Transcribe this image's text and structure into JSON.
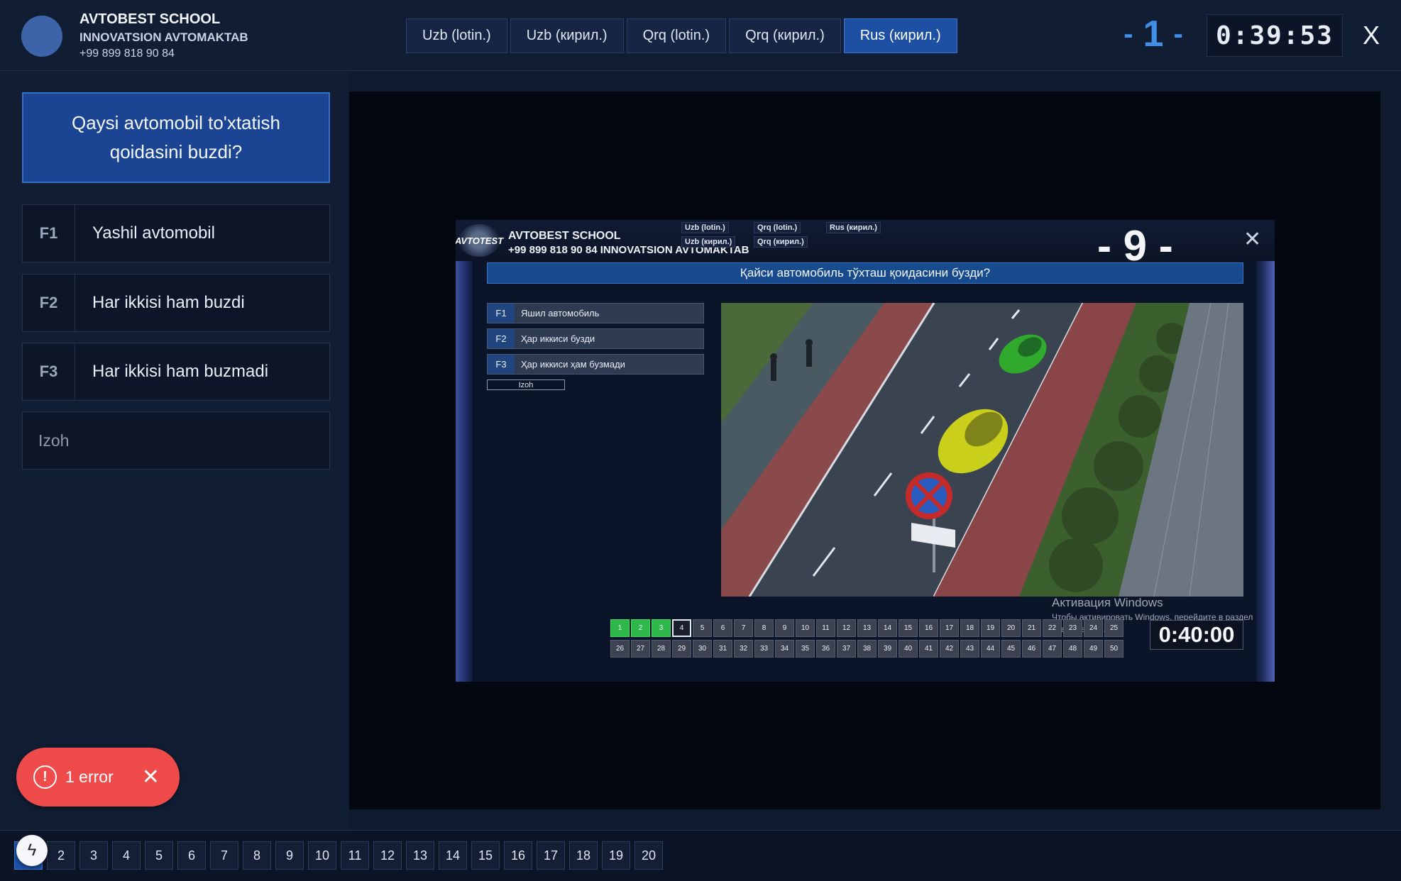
{
  "header": {
    "school_name": "AVTOBEST SCHOOL",
    "school_sub": "INNOVATSION AVTOMAKTAB",
    "phone": "+99 899 818 90 84",
    "languages": [
      "Uzb (lotin.)",
      "Uzb (кирил.)",
      "Qrq (lotin.)",
      "Qrq (кирил.)",
      "Rus (кирил.)"
    ],
    "active_language": "Rus (кирил.)",
    "question_number": "1",
    "dash": "-",
    "timer": "0:39:53",
    "close_label": "X"
  },
  "left_panel": {
    "question": "Qaysi avtomobil to'xtatish qoidasini buzdi?",
    "answers": [
      {
        "key": "F1",
        "text": "Yashil avtomobil"
      },
      {
        "key": "F2",
        "text": "Har ikkisi ham buzdi"
      },
      {
        "key": "F3",
        "text": "Har ikkisi ham buzmadi"
      }
    ],
    "izoh": "Izoh"
  },
  "error_toast": {
    "label": "1 error",
    "icon": "!",
    "close": "✕"
  },
  "screenshot": {
    "logo_text": "AVTOTEST",
    "title": "AVTOBEST SCHOOL",
    "subtitle": "+99 899 818 90 84 INNOVATSION AVTOMAKTAB",
    "languages": [
      "Uzb (lotin.)",
      "Qrq (lotin.)",
      "Rus (кирил.)",
      "Uzb (кирил.)",
      "Qrq (кирил.)"
    ],
    "question_number": "- 9 -",
    "question": "Қайси автомобиль тўхташ қоидасини бузди?",
    "answers": [
      {
        "key": "F1",
        "text": "Яшил автомобиль"
      },
      {
        "key": "F2",
        "text": "Ҳар иккиси бузди"
      },
      {
        "key": "F3",
        "text": "Ҳар иккиси ҳам бузмади"
      }
    ],
    "izoh": "Izoh",
    "grid_row1": [
      "1",
      "2",
      "3",
      "4",
      "5",
      "6",
      "7",
      "8",
      "9",
      "10",
      "11",
      "12",
      "13",
      "14",
      "15",
      "16",
      "17",
      "18",
      "19",
      "20",
      "21",
      "22",
      "23",
      "24",
      "25"
    ],
    "grid_row2": [
      "26",
      "27",
      "28",
      "29",
      "30",
      "31",
      "32",
      "33",
      "34",
      "35",
      "36",
      "37",
      "38",
      "39",
      "40",
      "41",
      "42",
      "43",
      "44",
      "45",
      "46",
      "47",
      "48",
      "49",
      "50"
    ],
    "answered_count": 3,
    "current_question": "4",
    "timer": "0:40:00",
    "windows_activation_title": "Активация Windows",
    "windows_activation_text": "Чтобы активировать Windows, перейдите в раздел \"Параметры\"."
  },
  "pager": {
    "pages": [
      "1",
      "2",
      "3",
      "4",
      "5",
      "6",
      "7",
      "8",
      "9",
      "10",
      "11",
      "12",
      "13",
      "14",
      "15",
      "16",
      "17",
      "18",
      "19",
      "20"
    ],
    "active": "1"
  },
  "colors": {
    "accent": "#1d4fa3",
    "error": "#ef4b4b",
    "done": "#2fb84a"
  }
}
